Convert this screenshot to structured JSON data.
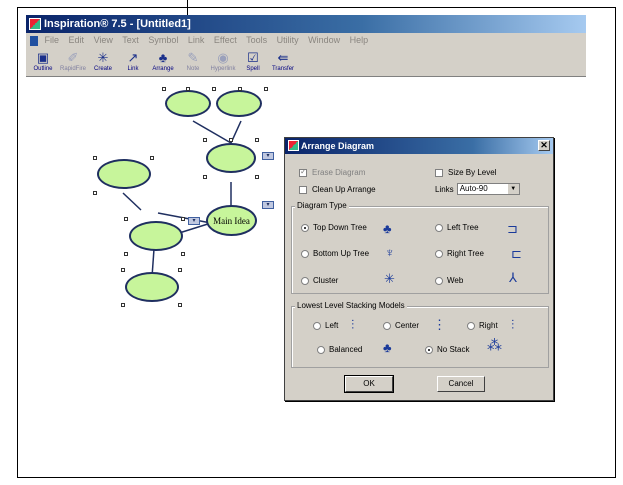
{
  "window": {
    "title": "Inspiration® 7.5 - [Untitled1]"
  },
  "menu": {
    "items": [
      "File",
      "Edit",
      "View",
      "Text",
      "Symbol",
      "Link",
      "Effect",
      "Tools",
      "Utility",
      "Window",
      "Help"
    ]
  },
  "toolbar": {
    "buttons": [
      {
        "label": "Outline",
        "icon": "outline-icon",
        "enabled": true
      },
      {
        "label": "RapidFire",
        "icon": "rapidfire-icon",
        "enabled": false
      },
      {
        "label": "Create",
        "icon": "create-icon",
        "enabled": true
      },
      {
        "label": "Link",
        "icon": "link-icon",
        "enabled": true
      },
      {
        "label": "Arrange",
        "icon": "arrange-icon",
        "enabled": true
      },
      {
        "label": "Note",
        "icon": "note-icon",
        "enabled": false
      },
      {
        "label": "Hyperlink",
        "icon": "hyperlink-icon",
        "enabled": false
      },
      {
        "label": "Spell",
        "icon": "spell-icon",
        "enabled": true
      },
      {
        "label": "Transfer",
        "icon": "transfer-icon",
        "enabled": true
      }
    ]
  },
  "diagram": {
    "main_idea_label": "Main Idea"
  },
  "dialog": {
    "title": "Arrange Diagram",
    "erase_diagram": {
      "label": "Erase Diagram",
      "checked": true,
      "enabled": false
    },
    "size_by_level": {
      "label": "Size By Level",
      "checked": false
    },
    "clean_up_arrange": {
      "label": "Clean Up Arrange",
      "checked": false
    },
    "links_label": "Links",
    "links_value": "Auto-90",
    "diagram_type_label": "Diagram Type",
    "diagram_types": [
      {
        "label": "Top Down Tree",
        "selected": true,
        "icon": "top-down-tree-icon"
      },
      {
        "label": "Left Tree",
        "selected": false,
        "icon": "left-tree-icon"
      },
      {
        "label": "Bottom Up Tree",
        "selected": false,
        "icon": "bottom-up-tree-icon"
      },
      {
        "label": "Right Tree",
        "selected": false,
        "icon": "right-tree-icon"
      },
      {
        "label": "Cluster",
        "selected": false,
        "icon": "cluster-icon"
      },
      {
        "label": "Web",
        "selected": false,
        "icon": "web-icon"
      }
    ],
    "stacking_label": "Lowest Level Stacking Models",
    "stacking_models": [
      {
        "label": "Left",
        "selected": false,
        "icon": "stack-left-icon"
      },
      {
        "label": "Center",
        "selected": false,
        "icon": "stack-center-icon"
      },
      {
        "label": "Right",
        "selected": false,
        "icon": "stack-right-icon"
      },
      {
        "label": "Balanced",
        "selected": false,
        "icon": "stack-balanced-icon"
      },
      {
        "label": "No Stack",
        "selected": true,
        "icon": "no-stack-icon"
      }
    ],
    "ok_label": "OK",
    "cancel_label": "Cancel"
  }
}
